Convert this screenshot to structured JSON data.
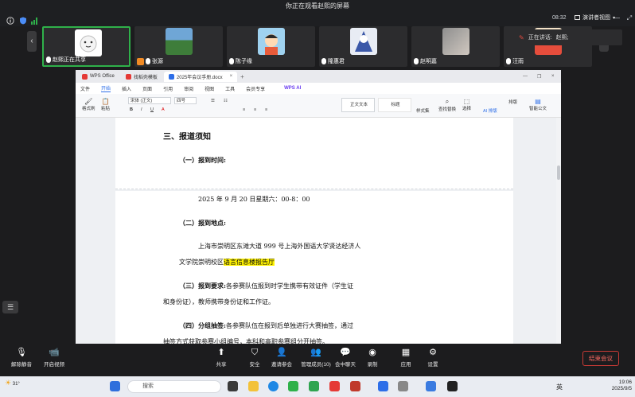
{
  "top": {
    "title": "你正在观看赵熙的屏幕",
    "time": "08:32",
    "view_mode": "演讲者视图"
  },
  "participants": [
    {
      "name": "赵熙正在共享",
      "active": true
    },
    {
      "name": "张源"
    },
    {
      "name": "陈子缘"
    },
    {
      "name": "隆惠君"
    },
    {
      "name": "赵明嘉"
    },
    {
      "name": "汪雨"
    }
  ],
  "talking": {
    "label": "正在讲话:",
    "name": "赵熙;"
  },
  "wps": {
    "tabs": [
      "WPS Office",
      "找稻壳模板",
      "2025年会议手册.docx"
    ],
    "ai_label": "WPS AI",
    "menu": [
      "文件",
      "开始",
      "插入",
      "页面",
      "引用",
      "审阅",
      "视图",
      "工具",
      "会员专享"
    ],
    "ribbon": {
      "format_painter": "格式刷",
      "paste": "粘贴",
      "font": "宋体 (正文)",
      "size": "四号",
      "style_normal": "正文文本",
      "style_title": "标题",
      "styleset": "样式集",
      "find": "查找替换",
      "select": "选择",
      "ai_layout": "AI 排版",
      "layout": "排版",
      "smart_doc": "智能公文"
    }
  },
  "document": {
    "heading": "三、报道须知",
    "sec1": "（一）报到时间:",
    "date": "2025 年 9 月 20 日星期六：00-8：00",
    "sec2": "（二）报到地点:",
    "addr_line1": "上海市崇明区东滩大道 999 号上海外国语大学贤达经济人",
    "addr_line2_pre": "文学院崇明校区",
    "addr_line2_hl": "语言信息楼报告厅",
    "sec3_label": "（三）报到要求:",
    "sec3_text": "各参赛队伍报到时学生携带有效证件（学生证",
    "sec3_line2": "和身份证），教师携带身份证和工作证。",
    "sec4_label": "（四）分组抽签:",
    "sec4_text": "各参赛队伍在报到后单独进行大赛抽签，通过",
    "sec4_line2": "抽签方式获取参赛小组编号，本科和高职参赛组分开抽签。"
  },
  "toolbar": {
    "unmute": "解除静音",
    "video": "开启视频",
    "share": "共享",
    "security": "安全",
    "invite": "邀请参会",
    "members": "管理成员(10)",
    "chat": "会中聊天",
    "record": "录制",
    "apps": "应用",
    "settings": "设置",
    "end": "结束会议"
  },
  "taskbar": {
    "weather": "31°",
    "search_placeholder": "搜索",
    "ime": "英",
    "clock_time": "19:06",
    "clock_date": "2025/9/5"
  },
  "colors": {
    "active_border": "#2fb14a",
    "accent": "#2d6ee8",
    "end_button": "#ff6b62",
    "highlight": "#fff200"
  }
}
